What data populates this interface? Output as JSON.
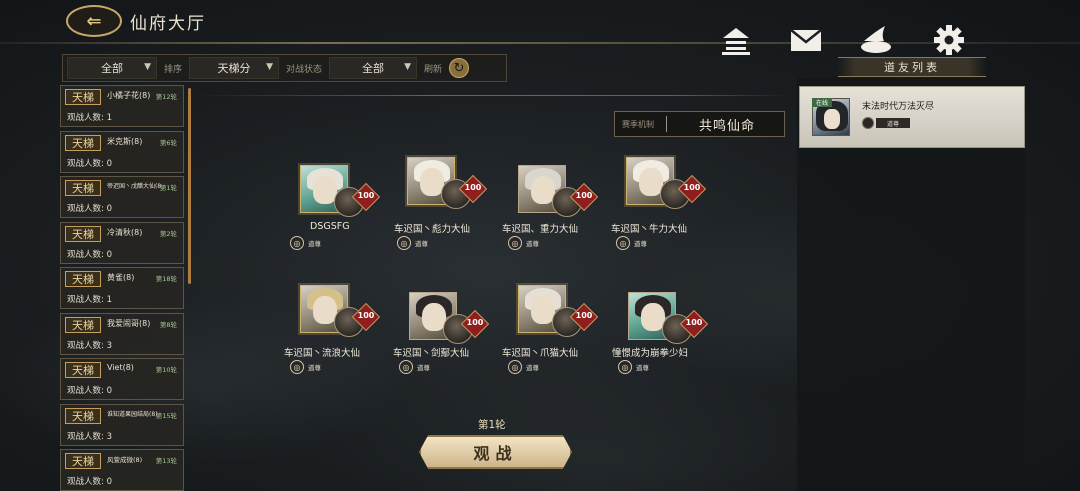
{
  "header": {
    "title": "仙府大厅"
  },
  "filters": {
    "all_option": "全部",
    "sort_label": "排序",
    "sort_value": "天梯分",
    "battle_status_label": "对战状态",
    "status_value": "全部",
    "refresh_label": "刷新"
  },
  "rooms": [
    {
      "tag": "天梯",
      "name": "小橘子花(8)",
      "round": "第12轮",
      "watch": "观战人数: 1"
    },
    {
      "tag": "天梯",
      "name": "米克斯(8)",
      "round": "第6轮",
      "watch": "观战人数: 0"
    },
    {
      "tag": "天梯",
      "name": "帝迟国丶戊醋大仙(8)",
      "round": "第1轮",
      "watch": "观战人数: 0"
    },
    {
      "tag": "天梯",
      "name": "冷清秋(8)",
      "round": "第2轮",
      "watch": "观战人数: 0"
    },
    {
      "tag": "天梯",
      "name": "黄雀(8)",
      "round": "第18轮",
      "watch": "观战人数: 1"
    },
    {
      "tag": "天梯",
      "name": "我爱闹哥(8)",
      "round": "第8轮",
      "watch": "观战人数: 3"
    },
    {
      "tag": "天梯",
      "name": "Viet(8)",
      "round": "第10轮",
      "watch": "观战人数: 0"
    },
    {
      "tag": "天梯",
      "name": "谁知道果园结局(8)",
      "round": "第15轮",
      "watch": "观战人数: 3"
    },
    {
      "tag": "天梯",
      "name": "风萱成微(8)",
      "round": "第13轮",
      "watch": "观战人数: 0"
    }
  ],
  "season": {
    "label": "赛季机制",
    "value": "共鸣仙命"
  },
  "players": [
    {
      "name": "DSGSFG",
      "level": "100",
      "rank": "道尊"
    },
    {
      "name": "车迟国丶彪力大仙",
      "level": "100",
      "rank": "道尊"
    },
    {
      "name": "车迟国、重力大仙",
      "level": "100",
      "rank": "道尊"
    },
    {
      "name": "车迟国丶牛力大仙",
      "level": "100",
      "rank": "道尊"
    },
    {
      "name": "车迟国丶流浪大仙",
      "level": "100",
      "rank": "道尊"
    },
    {
      "name": "车迟国丶剑鄢大仙",
      "level": "100",
      "rank": "道尊"
    },
    {
      "name": "车迟国丶爪猫大仙",
      "level": "100",
      "rank": "道尊"
    },
    {
      "name": "憧憬成为崩拳少妇",
      "level": "100",
      "rank": "道尊"
    }
  ],
  "battle": {
    "round_label": "第1轮",
    "spectate_label": "观战"
  },
  "friends_panel": {
    "title": "道友列表",
    "friends": [
      {
        "status": "在线",
        "name": "末法时代万法灭尽",
        "rank": "道尊"
      }
    ]
  },
  "icons": [
    "back-arrow-icon",
    "home-icon",
    "mail-icon",
    "hat-icon",
    "gear-icon",
    "refresh-icon",
    "rank-icon"
  ]
}
